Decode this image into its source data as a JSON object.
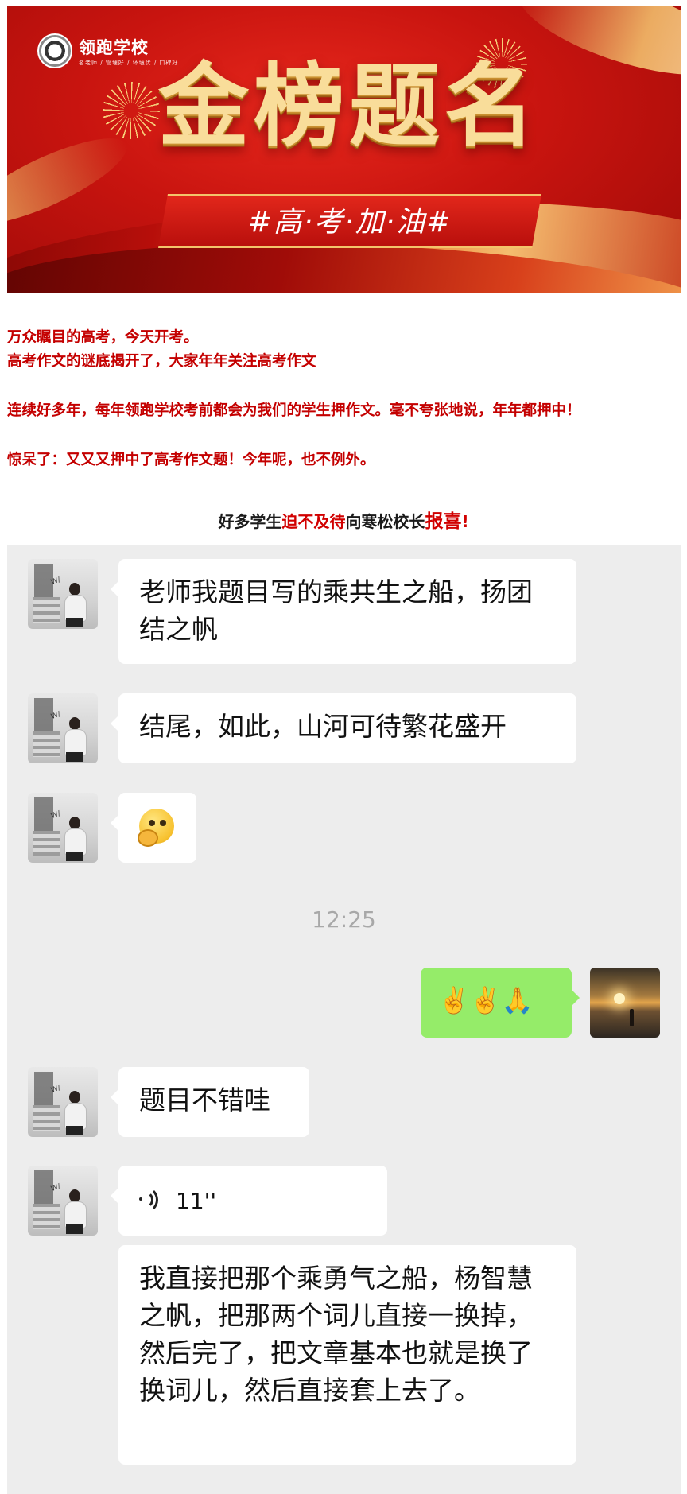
{
  "banner": {
    "school_name": "领跑学校",
    "school_tagline": "名老师 / 管理好 / 环境优 / 口碑好",
    "headline": "金榜题名",
    "slogan": "#高·考·加·油#"
  },
  "article": {
    "lines": [
      "万众瞩目的高考，今天开考。",
      "高考作文的谜底揭开了，大家年年关注高考作文",
      "连续好多年，每年领跑学校考前都会为我们的学生押作文。毫不夸张地说，年年都押中！",
      "惊呆了：又又又押中了高考作文题！今年呢，也不例外。"
    ],
    "highlight": {
      "part1": "好多学生",
      "part2": "迫不及待",
      "part3": "向寒松校长",
      "part4": "报喜",
      "part5": "!"
    }
  },
  "chat": {
    "messages": [
      {
        "sender": "student",
        "text": "老师我题目写的乘共生之船，扬团结之帆"
      },
      {
        "sender": "student",
        "text": "结尾，如此，山河可待繁花盛开"
      },
      {
        "sender": "student",
        "emoji": "thinking-face"
      },
      {
        "sender": "teacher",
        "emoji_text": "✌️✌️🙏"
      },
      {
        "sender": "student",
        "text": "题目不错哇"
      },
      {
        "sender": "student",
        "voice_duration": "11''"
      },
      {
        "sender": "student",
        "text": "我直接把那个乘勇气之船，杨智慧之帆，把那两个词儿直接一换掉，然后完了，把文章基本也就是换了换词儿，然后直接套上去了。"
      }
    ],
    "timestamp": "12:25"
  }
}
